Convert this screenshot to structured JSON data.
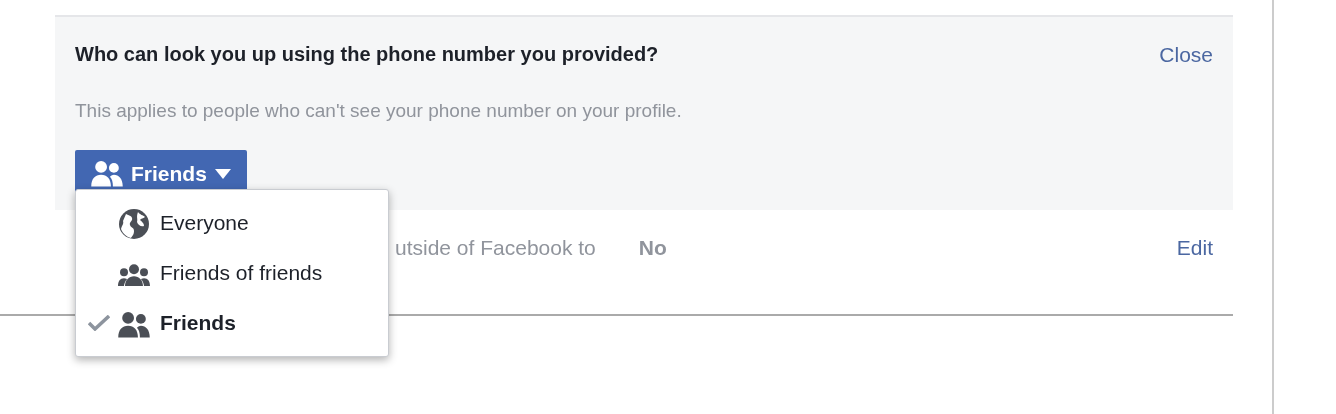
{
  "panel": {
    "question": "Who can look you up using the phone number you provided?",
    "close_link": "Close",
    "description": "This applies to people who can't see your phone number on your profile.",
    "audience_button": {
      "label": "Friends",
      "kind": "friends"
    }
  },
  "dropdown": {
    "items": [
      {
        "label": "Everyone",
        "kind": "globe",
        "selected": false
      },
      {
        "label": "Friends of friends",
        "kind": "group",
        "selected": false
      },
      {
        "label": "Friends",
        "kind": "friends",
        "selected": true
      }
    ]
  },
  "setting_row": {
    "label": "utside of Facebook to",
    "value": "No",
    "edit_link": "Edit"
  }
}
